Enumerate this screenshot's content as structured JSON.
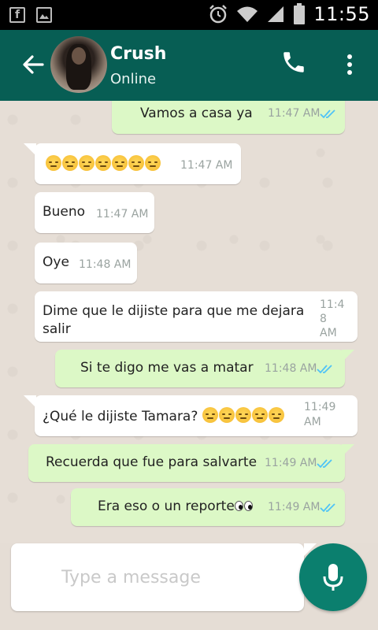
{
  "status_bar": {
    "time": "11:55",
    "facebook_glyph": "f",
    "left_icons": [
      "facebook-icon",
      "gallery-icon"
    ],
    "right_icons": [
      "alarm-icon",
      "wifi-icon",
      "signal-icon",
      "battery-icon"
    ]
  },
  "header": {
    "contact_name": "Crush",
    "contact_status": "Online",
    "icons": [
      "back-arrow-icon",
      "call-icon",
      "more-vert-icon"
    ]
  },
  "messages": [
    {
      "dir": "out",
      "text": "Vamos a casa ya",
      "time": "11:47 AM",
      "read": true
    },
    {
      "dir": "in",
      "emoji": "pensive-face",
      "emoji_count": 7,
      "time": "11:47 AM"
    },
    {
      "dir": "in",
      "text": "Bueno",
      "time": "11:47 AM"
    },
    {
      "dir": "in",
      "text": "Oye",
      "time": "11:48 AM"
    },
    {
      "dir": "in",
      "text": "Dime que le dijiste para que me dejara salir",
      "time": "11:48 AM"
    },
    {
      "dir": "out",
      "text": "Si te digo me vas a matar",
      "time": "11:48 AM",
      "read": true
    },
    {
      "dir": "in",
      "text": "¿Qué le dijiste Tamara?",
      "emoji": "unamused-face",
      "emoji_count": 5,
      "time": "11:49 AM"
    },
    {
      "dir": "out",
      "text": "Recuerda que fue para salvarte",
      "time": "11:49 AM",
      "read": true
    },
    {
      "dir": "out",
      "text": "Era eso o un reporte",
      "emoji": "eyes",
      "time": "11:49 AM",
      "read": true
    }
  ],
  "msg_time_wrapped": {
    "dimela": [
      "11:4",
      "8",
      "AM"
    ],
    "tamara": [
      "11:49",
      "AM"
    ]
  },
  "composer": {
    "placeholder": "Type a message",
    "icon": "mic-icon"
  },
  "colors": {
    "header": "#075e54",
    "outgoing": "#dcf8c6",
    "incoming": "#ffffff",
    "ticks": "#4fc3f7",
    "mic_button": "#0b7f6e"
  }
}
